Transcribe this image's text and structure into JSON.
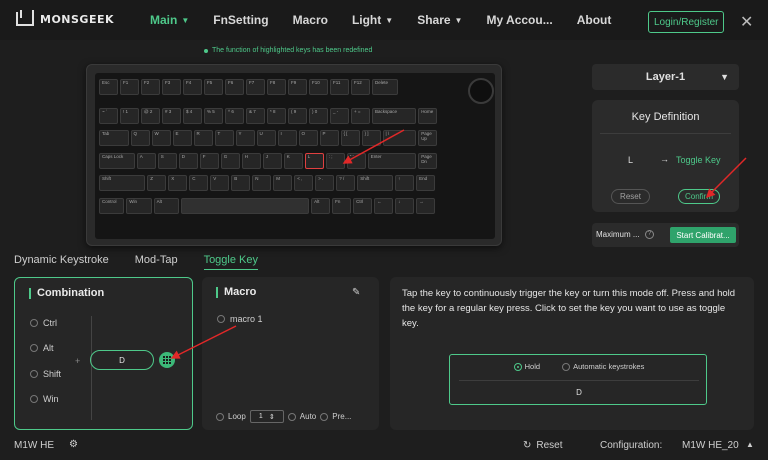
{
  "app": {
    "brand": "MONSGEEK",
    "nav": [
      {
        "label": "Main",
        "dropdown": true,
        "active": true
      },
      {
        "label": "FnSetting",
        "dropdown": false,
        "active": false
      },
      {
        "label": "Macro",
        "dropdown": false,
        "active": false
      },
      {
        "label": "Light",
        "dropdown": true,
        "active": false
      },
      {
        "label": "Share",
        "dropdown": true,
        "active": false
      },
      {
        "label": "My Accou...",
        "dropdown": false,
        "active": false
      },
      {
        "label": "About",
        "dropdown": false,
        "active": false
      }
    ],
    "login_label": "Login/Register",
    "accent_color": "#4ec98a"
  },
  "notice": "The function of highlighted keys has been redefined",
  "keyboard": {
    "rows": [
      [
        "Esc",
        "F1",
        "F2",
        "F3",
        "F4",
        "F5",
        "F6",
        "F7",
        "F8",
        "F9",
        "F10",
        "F11",
        "F12",
        "Delete"
      ],
      [
        "~ `",
        "! 1",
        "@ 2",
        "# 3",
        "$ 4",
        "% 5",
        "^ 6",
        "& 7",
        "* 8",
        "( 9",
        ") 0",
        "_ -",
        "+ =",
        "Backspace",
        "Home"
      ],
      [
        "Tab",
        "Q",
        "W",
        "E",
        "R",
        "T",
        "Y",
        "U",
        "I",
        "O",
        "P",
        "{ [",
        "} ]",
        "| \\",
        "Page Up"
      ],
      [
        "Caps Lock",
        "A",
        "S",
        "D",
        "F",
        "G",
        "H",
        "J",
        "K",
        "L",
        ": ;",
        "\" '",
        "Enter",
        "Page Dn"
      ],
      [
        "Shift",
        "Z",
        "X",
        "C",
        "V",
        "B",
        "N",
        "M",
        "< ,",
        "> .",
        "? /",
        "Shift",
        "↑",
        "End"
      ],
      [
        "Control",
        "Win",
        "Alt",
        "",
        "Alt",
        "Fn",
        "Ctrl",
        "←",
        "↓",
        "→"
      ]
    ],
    "highlighted_key": "L"
  },
  "layer": {
    "selected": "Layer-1"
  },
  "key_definition": {
    "title": "Key Definition",
    "from": "L",
    "arrow": "→",
    "to": "Toggle Key",
    "reset_label": "Reset",
    "confirm_label": "Confirm"
  },
  "calibration": {
    "label": "Maximum ...",
    "help_icon": "?",
    "button": "Start Calibrat..."
  },
  "mode_tabs": [
    {
      "label": "Dynamic Keystroke",
      "active": false
    },
    {
      "label": "Mod-Tap",
      "active": false
    },
    {
      "label": "Toggle Key",
      "active": true
    }
  ],
  "combination": {
    "title": "Combination",
    "modifiers": [
      "Ctrl",
      "Alt",
      "Shift",
      "Win"
    ],
    "plus": "+",
    "key": "D"
  },
  "macro": {
    "title": "Macro",
    "items": [
      "macro 1"
    ],
    "loop_label": "Loop",
    "loop_value": "1",
    "auto_label": "Auto",
    "press_label": "Pre..."
  },
  "description": {
    "text": "Tap the key to continuously trigger the key or turn this mode off. Press and hold the key for a regular key press. Click to set the key you want to use as toggle key.",
    "options": [
      "Hold",
      "Automatic keystrokes"
    ],
    "selected_option": "Hold",
    "key": "D"
  },
  "footer": {
    "device": "M1W HE",
    "reset_label": "Reset",
    "config_label": "Configuration:",
    "config_value": "M1W HE_20"
  }
}
